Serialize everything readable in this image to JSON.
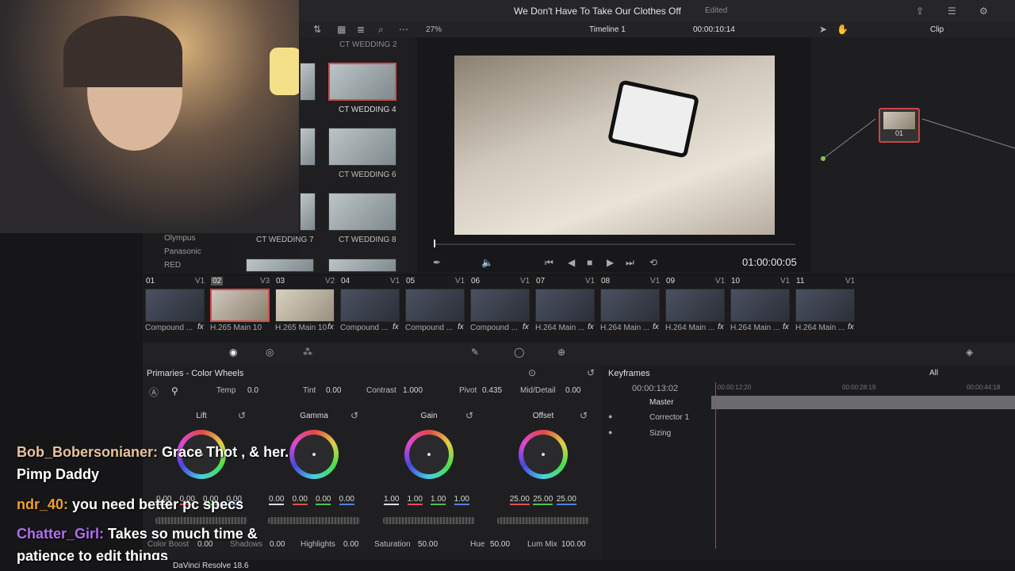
{
  "header": {
    "title": "We Don't Have To Take Our Clothes Off",
    "status": "Edited"
  },
  "viewer": {
    "zoom": "27%",
    "timeline": "Timeline 1",
    "timecode_top": "00:00:10:14",
    "timecode": "01:00:00:05",
    "mode": "Clip"
  },
  "media_pool": {
    "clips": [
      {
        "label": "CT WEDDING 2"
      },
      {
        "label": "CT WEDDING 4"
      },
      {
        "label": "CT WEDDING 6"
      },
      {
        "label": "CT WEDDING 7"
      },
      {
        "label": "CT WEDDING 8"
      }
    ],
    "sidebar": [
      "Olympus",
      "Panasonic",
      "RED"
    ]
  },
  "node": {
    "label": "01"
  },
  "clips": [
    {
      "num": "01",
      "track": "V1",
      "name": "Compound ..."
    },
    {
      "num": "02",
      "track": "V3",
      "name": "H.265 Main 10 ..."
    },
    {
      "num": "03",
      "track": "V2",
      "name": "H.265 Main 10 ..."
    },
    {
      "num": "04",
      "track": "V1",
      "name": "Compound ..."
    },
    {
      "num": "05",
      "track": "V1",
      "name": "Compound ..."
    },
    {
      "num": "06",
      "track": "V1",
      "name": "Compound ..."
    },
    {
      "num": "07",
      "track": "V1",
      "name": "H.264 Main ..."
    },
    {
      "num": "08",
      "track": "V1",
      "name": "H.264 Main ..."
    },
    {
      "num": "09",
      "track": "V1",
      "name": "H.264 Main ..."
    },
    {
      "num": "10",
      "track": "V1",
      "name": "H.264 Main ..."
    },
    {
      "num": "11",
      "track": "V1",
      "name": "H.264 Main ..."
    }
  ],
  "primaries": {
    "title": "Primaries - Color Wheels",
    "temp_label": "Temp",
    "temp": "0.0",
    "tint_label": "Tint",
    "tint": "0.00",
    "contrast_label": "Contrast",
    "contrast": "1.000",
    "pivot_label": "Pivot",
    "pivot": "0.435",
    "middetail_label": "Mid/Detail",
    "middetail": "0.00",
    "wheels": [
      {
        "name": "Lift",
        "values": [
          "0.00",
          "0.00",
          "0.00",
          "0.00"
        ]
      },
      {
        "name": "Gamma",
        "values": [
          "0.00",
          "0.00",
          "0.00",
          "0.00"
        ]
      },
      {
        "name": "Gain",
        "values": [
          "1.00",
          "1.00",
          "1.00",
          "1.00"
        ]
      },
      {
        "name": "Offset",
        "values": [
          "25.00",
          "25.00",
          "25.00"
        ]
      }
    ],
    "colorboost_label": "Color Boost",
    "colorboost": "0.00",
    "shadows_label": "Shadows",
    "shadows": "0.00",
    "highlights_label": "Highlights",
    "highlights": "0.00",
    "saturation_label": "Saturation",
    "saturation": "50.00",
    "hue_label": "Hue",
    "hue": "50.00",
    "lummix_label": "Lum Mix",
    "lummix": "100.00"
  },
  "keyframes": {
    "title": "Keyframes",
    "filter": "All",
    "timecode": "00:00:13:02",
    "ticks": [
      "00:00:12:20",
      "00:00:28:19",
      "00:00:44:18"
    ],
    "rows": [
      "Master",
      "Corrector 1",
      "Sizing"
    ]
  },
  "app": {
    "name": "DaVinci Resolve 18.6"
  },
  "chat": [
    {
      "user": "Bob_Bobersonianer:",
      "msg": "Grace Thot , & her.",
      "msg2": "Pimp Daddy",
      "color": "#e8c39e"
    },
    {
      "user": "ndr_40:",
      "msg": "you need better pc specs",
      "color": "#f0a030"
    },
    {
      "user": "Chatter_Girl:",
      "msg": "Takes so much time &",
      "msg2": "patience to edit things",
      "color": "#b070f0"
    }
  ]
}
